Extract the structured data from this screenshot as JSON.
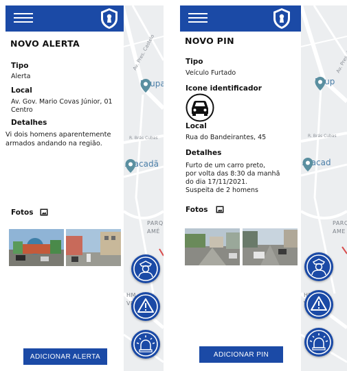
{
  "left": {
    "title": "NOVO ALERTA",
    "tipo_label": "Tipo",
    "tipo_value": "Alerta",
    "local_label": "Local",
    "local_value_line1": "Av. Gov. Mario Covas Júnior, 01",
    "local_value_line2": "Centro",
    "detalhes_label": "Detalhes",
    "detalhes_line1": "Vi dois homens aparentemente",
    "detalhes_line2": "armados andando na região.",
    "fotos_label": "Fotos",
    "button_label": "ADICIONAR ALERTA",
    "map": {
      "poi1": "Poupa",
      "poi2": "Atacadã",
      "road1": "Av. Pres. Castelo",
      "road2": "R. Brás Cubas",
      "area_line1": "PARQ",
      "area_line2": "AMÉ",
      "area2": "HM",
      "area3": "VE"
    }
  },
  "right": {
    "title": "NOVO PIN",
    "tipo_label": "Tipo",
    "tipo_value": "Veículo Furtado",
    "icone_label": "Icone identificador",
    "local_label": "Local",
    "local_value": "Rua do Bandeirantes, 45",
    "detalhes_label": "Detalhes",
    "detalhes_line1": "Furto de um carro preto,",
    "detalhes_line2": "por volta das 8:30 da manhã",
    "detalhes_line3": "do dia 17/11/2021.",
    "detalhes_line4": "Suspeita de 2 homens",
    "fotos_label": "Fotos",
    "button_label": "ADICIONAR PIN",
    "map": {
      "poi1": "Poup",
      "poi2": "Atacad",
      "road1": "Av. Pres. Castelo",
      "road2": "R. Brás Cubas",
      "area_line1": "PARQ",
      "area_line2": "AME",
      "area2": "HM",
      "area3": "VE"
    }
  },
  "colors": {
    "primary": "#1b4aa6",
    "poi_pin": "#5a8fa0",
    "poi_text": "#4a7ea8"
  },
  "icons": {
    "menu": "hamburger-icon",
    "brand": "shield-keyhole-icon",
    "fab1": "police-officer-icon",
    "fab2": "warning-triangle-icon",
    "fab3": "siren-icon",
    "photos": "image-icon",
    "identifier": "car-icon"
  }
}
